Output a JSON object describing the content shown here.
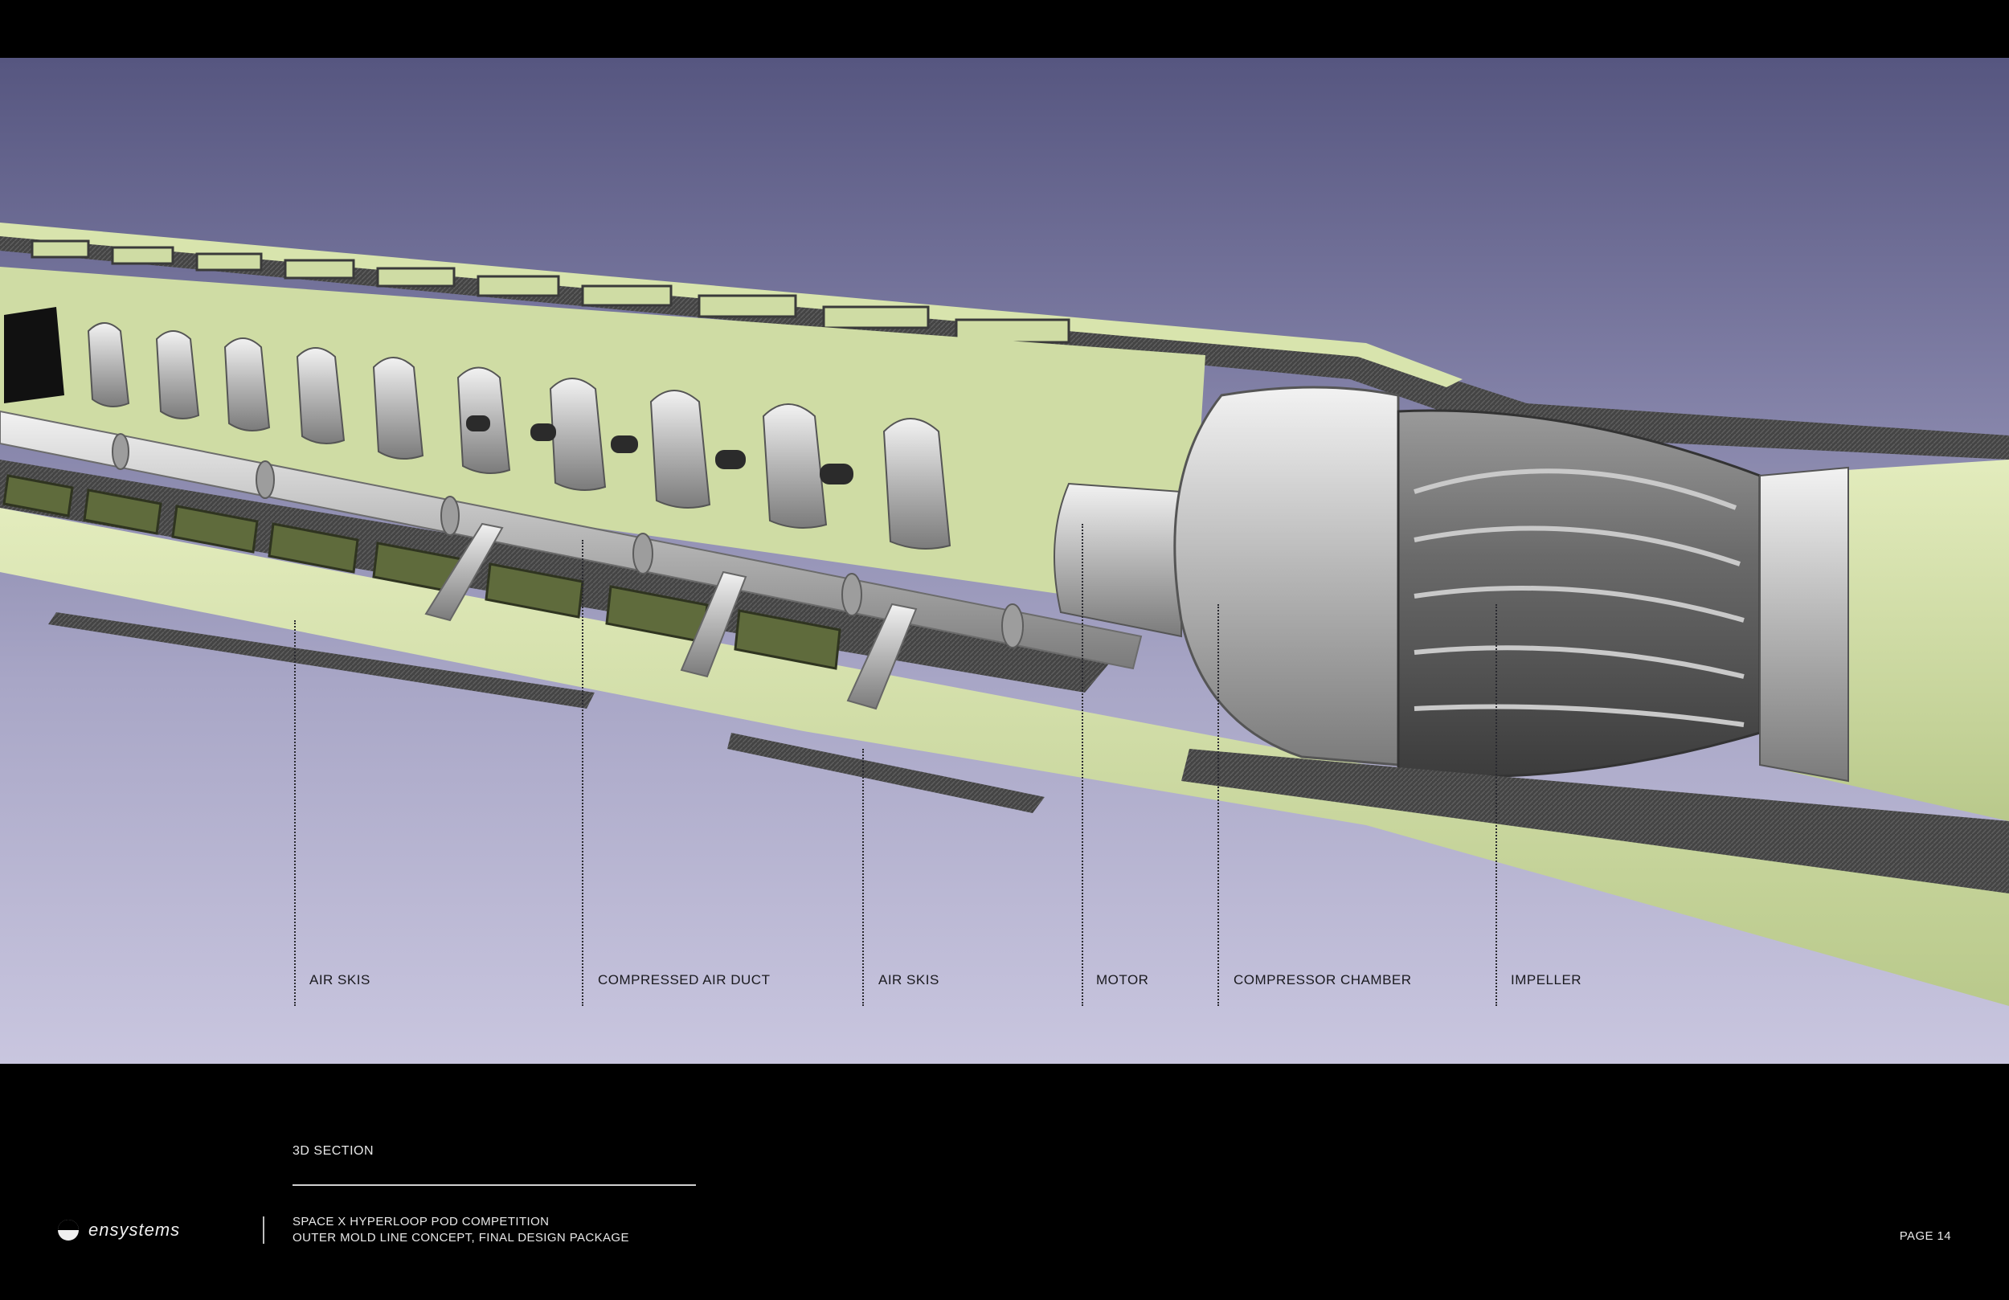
{
  "diagram": {
    "callouts": [
      {
        "label": "AIR SKIS"
      },
      {
        "label": "COMPRESSED AIR DUCT"
      },
      {
        "label": "AIR SKIS"
      },
      {
        "label": "MOTOR"
      },
      {
        "label": "COMPRESSOR CHAMBER"
      },
      {
        "label": "IMPELLER"
      }
    ]
  },
  "footer": {
    "section_title": "3D SECTION",
    "logo_text": "ensystems",
    "project_title": "SPACE X HYPERLOOP POD COMPETITION",
    "project_subtitle": "OUTER MOLD LINE CONCEPT, FINAL DESIGN PACKAGE",
    "page_label": "PAGE 14"
  },
  "colors": {
    "hull_green": "#cfdca4",
    "carbon_grey": "#4a4a4a",
    "metal_grey": "#b8b8b8",
    "background_top": "#565680",
    "background_bottom": "#c9c6df"
  }
}
